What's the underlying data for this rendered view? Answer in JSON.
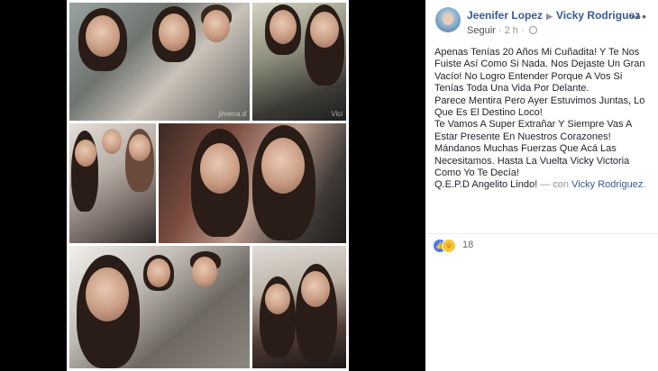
{
  "post": {
    "author": "Jeenifer Lopez",
    "recipient": "Vicky Rodriguez",
    "follow_label": "Seguir",
    "time": "2 h",
    "dot": "·",
    "more_icon": "ellipsis-icon",
    "caption_lines": [
      "Apenas Tenías 20 Años Mi Cuñadita! Y Te Nos Fuiste Así Como Si Nada. Nos Dejaste Un Gran Vacío! No Logro Entender Porque A Vos Si Tenías Toda Una Vida Por Delante.",
      "Parece Mentira Pero Ayer Estuvimos Juntas, Lo Que Es El Destino Loco!",
      "Te Vamos A Super Extrañar Y Siempre Vas A Estar Presente En Nuestros Corazones! Mándanos Muchas Fuerzas Que Acá Las Necesitamos. Hasta La Vuelta Vicky Victoria Como Yo Te Decía!"
    ],
    "caption_last": "Q.E.P.D Angelito Lindo!",
    "with_prefix": "— con",
    "with_name": "Vicky Rodriguez",
    "with_suffix": ".",
    "reactions": {
      "icons": [
        "like-icon",
        "haha-icon"
      ],
      "count": "18"
    },
    "colors": {
      "link": "#385898",
      "meta": "#90949c",
      "like": "#4a7bef",
      "haha": "#f7c537",
      "viewer_bg": "#000000"
    }
  },
  "photo": {
    "watermarks": [
      "jimena.d",
      "Vici"
    ]
  }
}
